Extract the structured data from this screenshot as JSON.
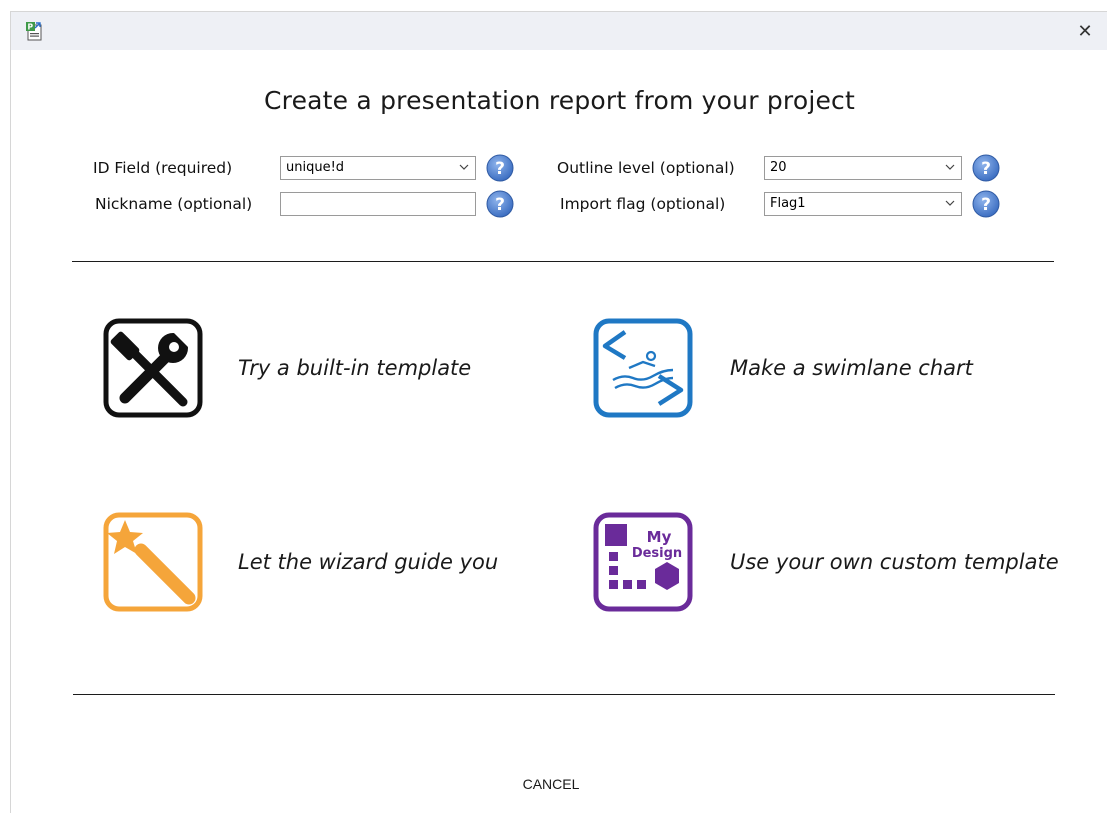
{
  "window": {
    "close_glyph": "✕"
  },
  "heading": "Create a presentation report from your project",
  "fields": {
    "id_field": {
      "label": "ID Field (required)",
      "value": "unique!d"
    },
    "nickname": {
      "label": "Nickname (optional)",
      "value": "",
      "placeholder": ""
    },
    "outline_level": {
      "label": "Outline level (optional)",
      "value": "20"
    },
    "import_flag": {
      "label": "Import flag (optional)",
      "value": "Flag1"
    }
  },
  "options": {
    "builtin": {
      "label": "Try a built-in template",
      "icon": "tools-icon",
      "color": "#111111"
    },
    "swimlane": {
      "label": "Make a swimlane chart",
      "icon": "swimmer-icon",
      "color": "#1f78c4"
    },
    "wizard": {
      "label": "Let the wizard guide you",
      "icon": "magic-wand-icon",
      "color": "#f5a53a"
    },
    "custom": {
      "label": "Use your own custom template",
      "icon": "my-design-icon",
      "color": "#6a2b9a",
      "icon_text_line1": "My",
      "icon_text_line2": "Design"
    }
  },
  "cancel_label": "CANCEL",
  "colors": {
    "help": "#4a7fd0",
    "titlebar": "#eef0f5"
  }
}
